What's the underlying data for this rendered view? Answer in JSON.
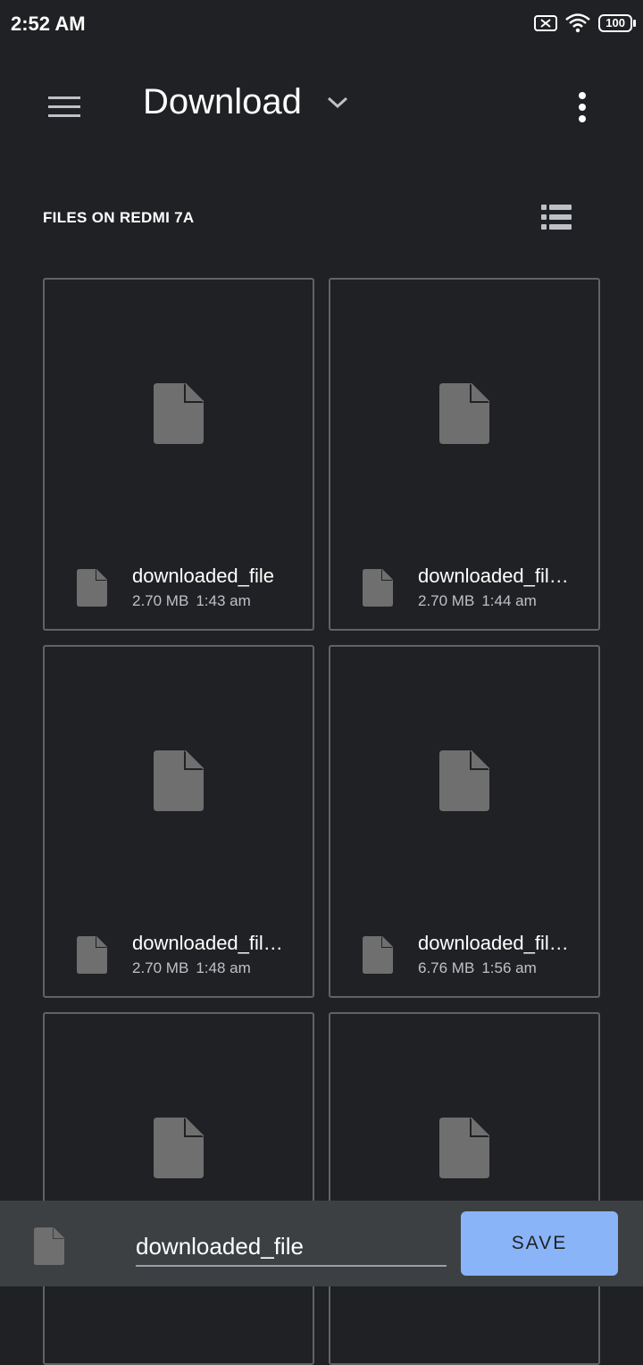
{
  "status_bar": {
    "time": "2:52 AM",
    "battery": "100",
    "icons": [
      "sim-off-icon",
      "wifi-icon",
      "battery-icon"
    ]
  },
  "app_bar": {
    "title": "Download",
    "icons": [
      "menu-icon",
      "chevron-down-icon",
      "more-vert-icon"
    ]
  },
  "section": {
    "header": "FILES ON REDMI 7A",
    "view_toggle_icon": "list-view-icon"
  },
  "files": [
    {
      "name": "downloaded_file",
      "size": "2.70 MB",
      "time": "1:43 am"
    },
    {
      "name": "downloaded_fil…",
      "size": "2.70 MB",
      "time": "1:44 am"
    },
    {
      "name": "downloaded_fil…",
      "size": "2.70 MB",
      "time": "1:48 am"
    },
    {
      "name": "downloaded_fil…",
      "size": "6.76 MB",
      "time": "1:56 am"
    },
    {
      "name": "",
      "size": "",
      "time": ""
    },
    {
      "name": "",
      "size": "",
      "time": ""
    }
  ],
  "bottom_bar": {
    "filename_value": "downloaded_file",
    "save_label": "SAVE"
  },
  "colors": {
    "background": "#202124",
    "card_border": "#5f6368",
    "file_icon": "#6f6f6f",
    "bottom_bar": "#3c4043",
    "accent": "#8ab4f8"
  }
}
